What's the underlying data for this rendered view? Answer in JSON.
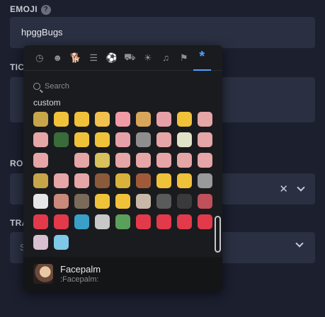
{
  "form": {
    "emoji_label": "EMOJI",
    "help_icon": "?",
    "emoji_value": "hpggBugs",
    "tick_label": "TICK",
    "role_label": "ROL",
    "trans_label": "TRA",
    "trans_text": "S",
    "clear_glyph": "✕"
  },
  "picker": {
    "categories": [
      {
        "icon": "clock-icon",
        "glyph": "◷"
      },
      {
        "icon": "smiley-icon",
        "glyph": "☻"
      },
      {
        "icon": "dog-icon",
        "glyph": "🐕"
      },
      {
        "icon": "burger-icon",
        "glyph": "☰"
      },
      {
        "icon": "football-icon",
        "glyph": "⚽"
      },
      {
        "icon": "car-icon",
        "glyph": "⛟"
      },
      {
        "icon": "bulb-icon",
        "glyph": "☀"
      },
      {
        "icon": "symbols-icon",
        "glyph": "♫"
      },
      {
        "icon": "flag-icon",
        "glyph": "⚑"
      },
      {
        "icon": "custom-asterisk-icon",
        "glyph": "*"
      }
    ],
    "search_placeholder": "Search",
    "category_title": "custom",
    "emoji_colors": [
      "#c7a64a",
      "#f0c23a",
      "#f0c23a",
      "#f2c04c",
      "#f19ba6",
      "#d8a65a",
      "#e8a0a8",
      "#f0c23a",
      "#e6a5a6",
      "#e6a5a6",
      "#3a6b3a",
      "#f0c23a",
      "#f0c23a",
      "#e8a0a8",
      "#8e8e8e",
      "#e6a5a6",
      "#e2e2c8",
      "#e6a5a6",
      "#e6a5a6",
      "",
      "#e6a5a6",
      "#d8c05a",
      "#e6a5a6",
      "#e6a5a6",
      "#e6a5a6",
      "#e6a5a6",
      "#e6a5a6",
      "#c7a64a",
      "#e6a5a6",
      "#e6a5a6",
      "#8a5a3a",
      "#d8b23a",
      "#a05a3a",
      "#f0c23a",
      "#f0c23a",
      "#9a9a9a",
      "#e6e6e6",
      "#c98a7a",
      "#7a6a5a",
      "#f0c23a",
      "#f0c23a",
      "#c9b8a8",
      "#5a5a5a",
      "#3a3a3a",
      "#c0505a",
      "#e23a4a",
      "#e23a4a",
      "#3aa0c8",
      "#c8c8c8",
      "#5aa05a",
      "#e23a4a",
      "#e23a4a",
      "#e23a4a",
      "#e23a4a",
      "#d8c0d0",
      "#7ec8e8"
    ],
    "preview_name": "Facepalm",
    "preview_code": ":Facepalm:"
  }
}
